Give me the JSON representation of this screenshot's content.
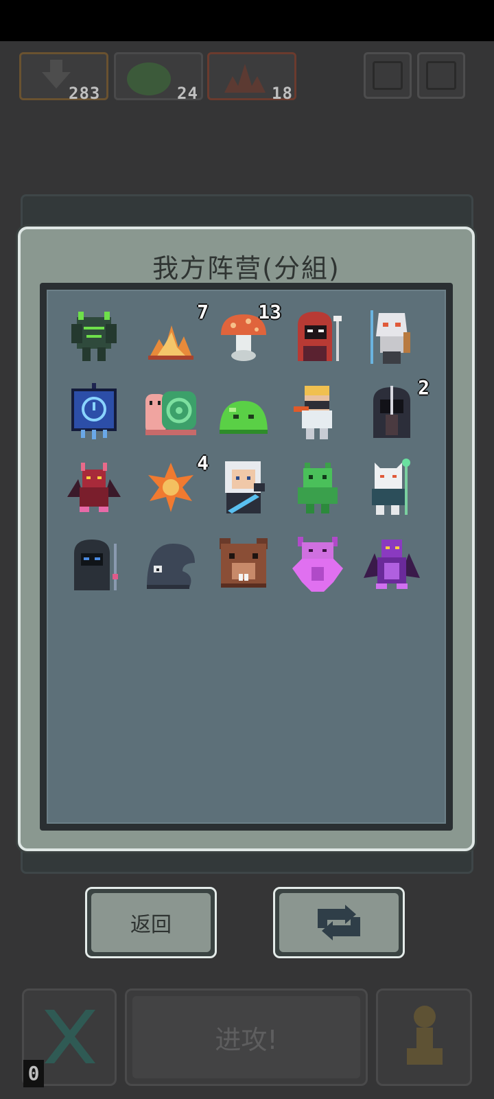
{
  "resources": [
    {
      "icon": "arrow-down-icon",
      "count": "283"
    },
    {
      "icon": "slime-icon",
      "count": "24"
    },
    {
      "icon": "flame-icon",
      "count": "18"
    }
  ],
  "modal": {
    "title": "我方阵营(分組)",
    "units": [
      {
        "name": "green-golem",
        "badge": ""
      },
      {
        "name": "fire-sprout",
        "badge": "7"
      },
      {
        "name": "mushroom",
        "badge": "13"
      },
      {
        "name": "red-hood-mage",
        "badge": ""
      },
      {
        "name": "skull-shaman",
        "badge": ""
      },
      {
        "name": "blue-banner",
        "badge": ""
      },
      {
        "name": "snail",
        "badge": ""
      },
      {
        "name": "green-slime",
        "badge": ""
      },
      {
        "name": "ninja",
        "badge": ""
      },
      {
        "name": "dark-knight",
        "badge": "2"
      },
      {
        "name": "red-demon",
        "badge": ""
      },
      {
        "name": "spiky-fire",
        "badge": "4"
      },
      {
        "name": "white-hair-hero",
        "badge": ""
      },
      {
        "name": "green-imp",
        "badge": ""
      },
      {
        "name": "white-beast",
        "badge": ""
      },
      {
        "name": "shadow-mage",
        "badge": ""
      },
      {
        "name": "dark-ghost",
        "badge": ""
      },
      {
        "name": "brown-rat",
        "badge": ""
      },
      {
        "name": "pink-demon",
        "badge": ""
      },
      {
        "name": "purple-dragon",
        "badge": ""
      }
    ]
  },
  "buttons": {
    "back_label": "返回",
    "swap_icon": "swap-arrows-icon"
  },
  "bottom_bar": {
    "attack_label": "进攻!",
    "counter": "0"
  }
}
